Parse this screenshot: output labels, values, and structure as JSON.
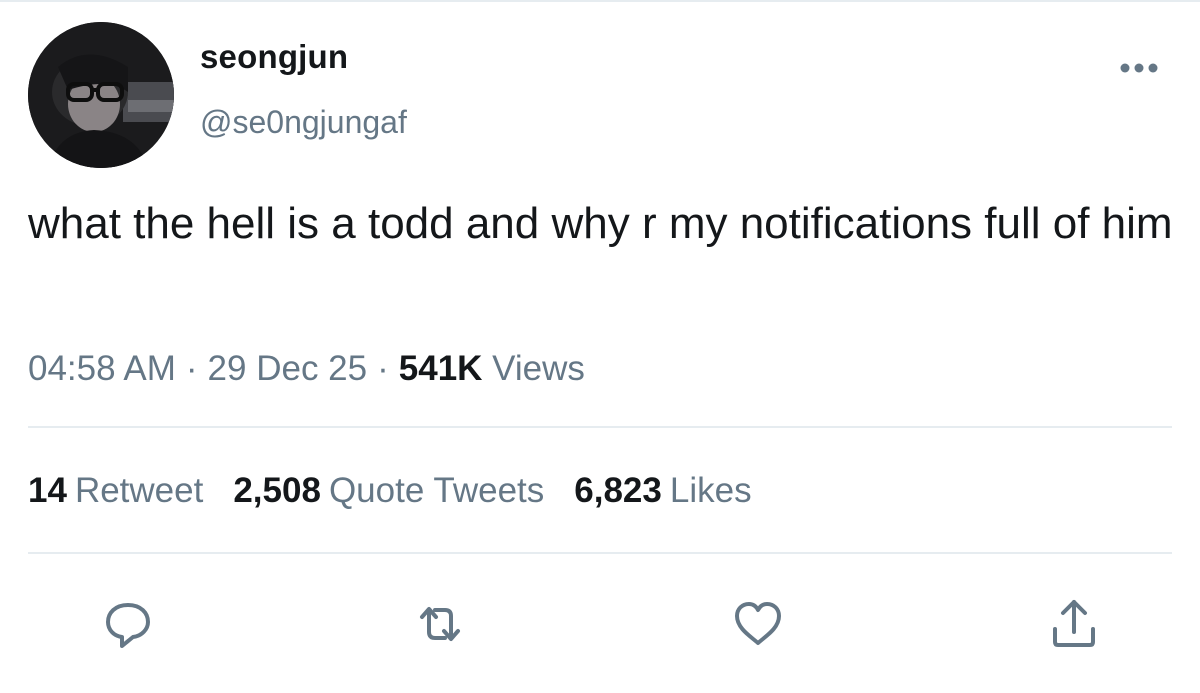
{
  "tweet": {
    "author": {
      "display_name": "seongjun",
      "handle": "@se0ngjungaf"
    },
    "text": "what the hell is a todd and why r my notifications full of him",
    "meta": {
      "time": "04:58 AM",
      "separator": "·",
      "date": "29 Dec 25",
      "views_count": "541K",
      "views_label": "Views"
    },
    "stats": [
      {
        "count": "14",
        "label": "Retweet"
      },
      {
        "count": "2,508",
        "label": "Quote Tweets"
      },
      {
        "count": "6,823",
        "label": "Likes"
      }
    ],
    "actions": [
      "reply-icon",
      "retweet-icon",
      "like-icon",
      "share-icon"
    ],
    "colors": {
      "text": "#14171a",
      "secondary": "#657786",
      "divider": "#e6ecf0",
      "action_icon": "#657786"
    }
  }
}
